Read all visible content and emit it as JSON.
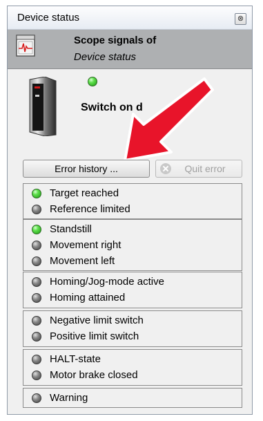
{
  "window": {
    "title": "Device status",
    "close_glyph": "⊗"
  },
  "scope": {
    "line1": "Scope signals of",
    "line2": "Device status"
  },
  "device": {
    "status_text": "Switch on d",
    "led": "on"
  },
  "buttons": {
    "error_history": "Error history ...",
    "quit_error": "Quit error"
  },
  "groups": [
    {
      "items": [
        {
          "label": "Target reached",
          "state": "on"
        },
        {
          "label": "Reference limited",
          "state": "off"
        }
      ]
    },
    {
      "items": [
        {
          "label": "Standstill",
          "state": "on"
        },
        {
          "label": "Movement right",
          "state": "off"
        },
        {
          "label": "Movement left",
          "state": "off"
        }
      ]
    },
    {
      "items": [
        {
          "label": "Homing/Jog-mode active",
          "state": "off"
        },
        {
          "label": "Homing attained",
          "state": "off"
        }
      ]
    },
    {
      "items": [
        {
          "label": "Negative limit switch",
          "state": "off"
        },
        {
          "label": "Positive limit switch",
          "state": "off"
        }
      ]
    },
    {
      "items": [
        {
          "label": "HALT-state",
          "state": "off"
        },
        {
          "label": "Motor brake closed",
          "state": "off"
        }
      ]
    },
    {
      "items": [
        {
          "label": "Warning",
          "state": "off"
        }
      ]
    }
  ],
  "colors": {
    "led_on": "#3ccf2a",
    "led_off": "#6b6b6b",
    "arrow": "#e8142a",
    "scope_band": "#aeb0b2"
  },
  "icons": {
    "scope": "scope-signal-icon",
    "device": "servo-drive-icon",
    "quit": "quit-error-icon"
  }
}
